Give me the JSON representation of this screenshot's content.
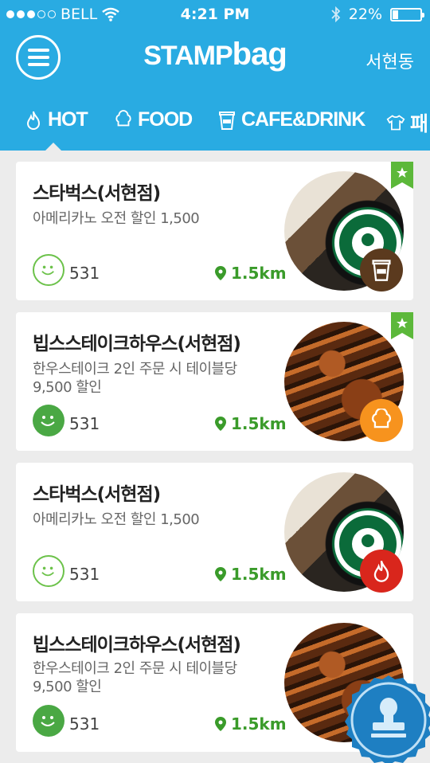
{
  "status": {
    "dots_on": 3,
    "dots_total": 5,
    "carrier": "BELL",
    "time": "4:21 PM",
    "battery_text": "22%",
    "battery_level": 0.22
  },
  "header": {
    "logo_part1": "STAMP",
    "logo_part2": "bag",
    "location": "서현동"
  },
  "tabs": [
    {
      "label": "HOT",
      "icon": "flame-icon"
    },
    {
      "label": "FOOD",
      "icon": "chef-hat-icon"
    },
    {
      "label": "CAFE&DRINK",
      "icon": "cup-icon"
    },
    {
      "label": "패",
      "icon": "tshirt-icon"
    }
  ],
  "cards": [
    {
      "name": "스타벅스(서현점)",
      "desc_line1": "아메리카노 오전 할인 1,500",
      "desc_line2": "",
      "count": "531",
      "distance": "1.5km",
      "image": "starbucks-logo",
      "category": "cup-icon",
      "category_color": "#5b3a1e",
      "bookmarked": true,
      "smile_filled": false
    },
    {
      "name": "빕스스테이크하우스(서현점)",
      "desc_line1": "한우스테이크 2인 주문 시 테이블당",
      "desc_line2": "9,500 할인",
      "count": "531",
      "distance": "1.5km",
      "image": "steak-photo",
      "category": "chef-hat-icon",
      "category_color": "#f7931e",
      "bookmarked": true,
      "smile_filled": true
    },
    {
      "name": "스타벅스(서현점)",
      "desc_line1": "아메리카노 오전 할인 1,500",
      "desc_line2": "",
      "count": "531",
      "distance": "1.5km",
      "image": "starbucks-logo",
      "category": "flame-icon",
      "category_color": "#d9261c",
      "bookmarked": false,
      "smile_filled": false
    },
    {
      "name": "빕스스테이크하우스(서현점)",
      "desc_line1": "한우스테이크 2인 주문 시 테이블당",
      "desc_line2": "9,500 할인",
      "count": "531",
      "distance": "1.5km",
      "image": "steak-photo",
      "category": "",
      "category_color": "",
      "bookmarked": false,
      "smile_filled": true
    }
  ],
  "fab": {
    "icon": "stamp-icon",
    "color": "#1e7fc2"
  }
}
